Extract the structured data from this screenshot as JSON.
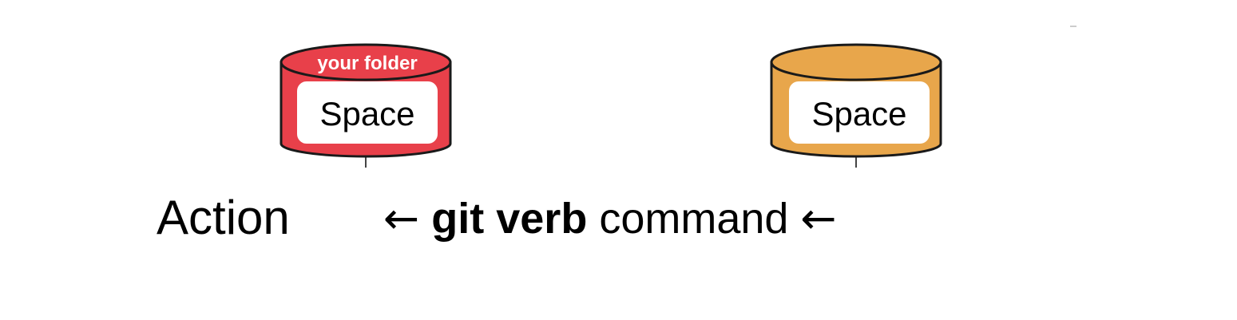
{
  "left_store": {
    "label": "your folder",
    "inner_text": "Space",
    "color": "#e8404a"
  },
  "right_store": {
    "inner_text": "Space",
    "color": "#e8a64b"
  },
  "action_label": "Action",
  "command": {
    "arrow_left": "←",
    "verb_bold": "git verb",
    "suffix": " command ",
    "arrow_right": "←"
  }
}
